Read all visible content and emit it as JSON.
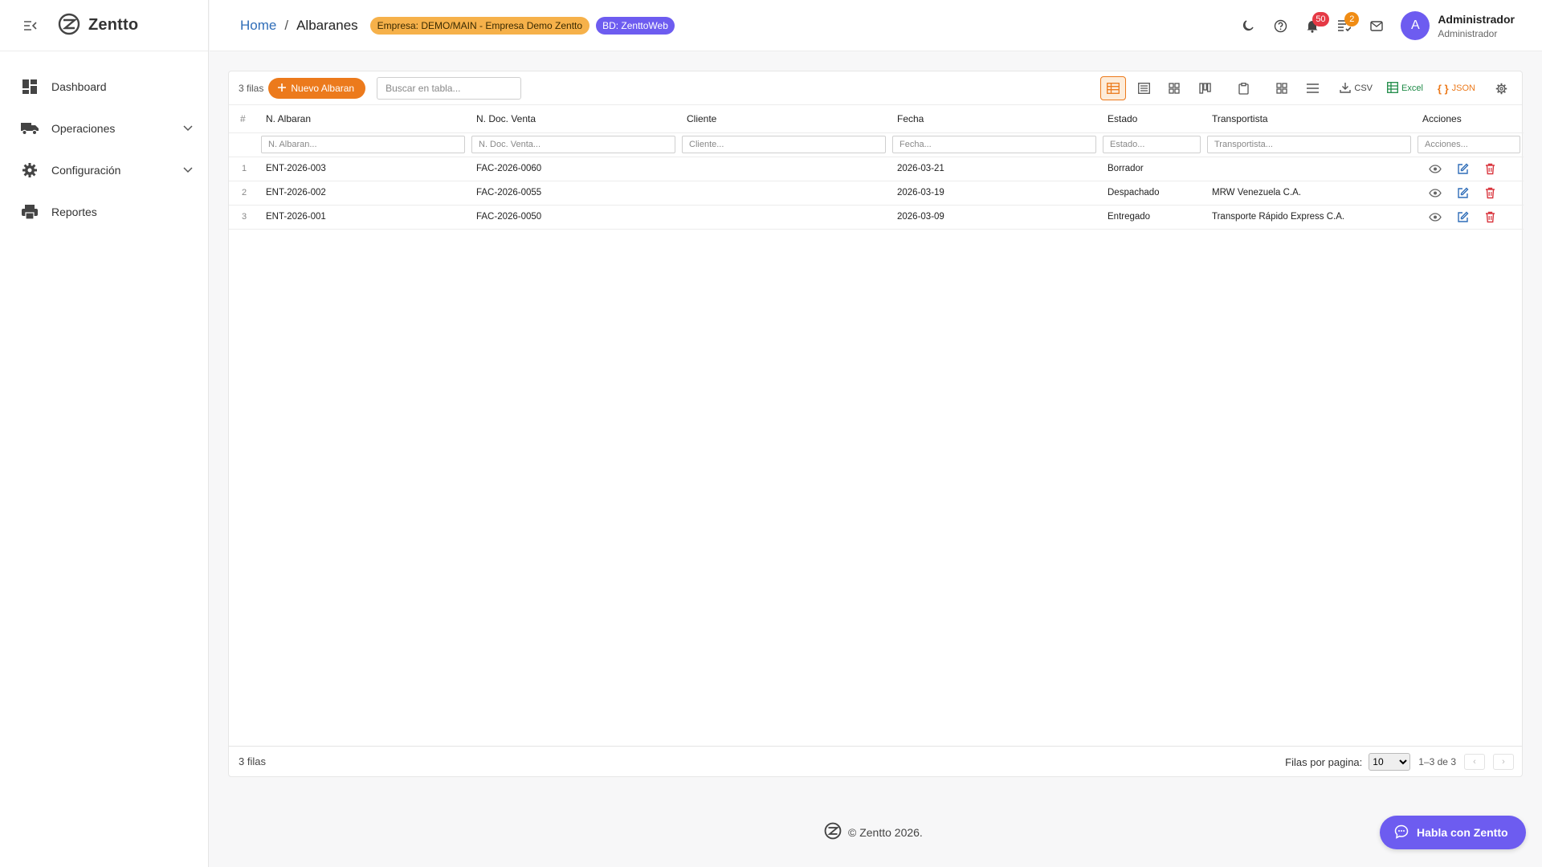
{
  "app": {
    "name": "Zentto"
  },
  "sidebar": {
    "items": [
      {
        "label": "Dashboard"
      },
      {
        "label": "Operaciones"
      },
      {
        "label": "Configuración"
      },
      {
        "label": "Reportes"
      }
    ]
  },
  "header": {
    "breadcrumb_home": "Home",
    "breadcrumb_sep": "/",
    "breadcrumb_current": "Albaranes",
    "company_badge": "Empresa: DEMO/MAIN - Empresa Demo Zentto",
    "db_badge": "BD: ZenttoWeb",
    "notifications_count": "50",
    "tasks_count": "2",
    "user_name": "Administrador",
    "user_role": "Administrador",
    "avatar_letter": "A"
  },
  "toolbar": {
    "rows_count": "3 filas",
    "new_button": "Nuevo Albaran",
    "search_placeholder": "Buscar en tabla...",
    "csv_label": "CSV",
    "excel_label": "Excel",
    "json_label": "JSON"
  },
  "table": {
    "index_header": "#",
    "columns": [
      "N. Albaran",
      "N. Doc. Venta",
      "Cliente",
      "Fecha",
      "Estado",
      "Transportista",
      "Acciones"
    ],
    "filters": [
      "N. Albaran...",
      "N. Doc. Venta...",
      "Cliente...",
      "Fecha...",
      "Estado...",
      "Transportista...",
      "Acciones..."
    ],
    "rows": [
      {
        "idx": "1",
        "albaran": "ENT-2026-003",
        "doc_venta": "FAC-2026-0060",
        "cliente": "",
        "fecha": "2026-03-21",
        "estado": "Borrador",
        "transportista": ""
      },
      {
        "idx": "2",
        "albaran": "ENT-2026-002",
        "doc_venta": "FAC-2026-0055",
        "cliente": "",
        "fecha": "2026-03-19",
        "estado": "Despachado",
        "transportista": "MRW Venezuela C.A."
      },
      {
        "idx": "3",
        "albaran": "ENT-2026-001",
        "doc_venta": "FAC-2026-0050",
        "cliente": "",
        "fecha": "2026-03-09",
        "estado": "Entregado",
        "transportista": "Transporte Rápido Express C.A."
      }
    ]
  },
  "footer": {
    "rows_total": "3 filas",
    "rows_per_page_label": "Filas por pagina:",
    "rows_per_page_value": "10",
    "range": "1–3 de 3",
    "prev": "‹",
    "next": "›"
  },
  "copyright": "© Zentto 2026.",
  "chat_button": "Habla con Zentto",
  "colors": {
    "accent_orange": "#ec7a1c",
    "brand_purple": "#6d5cf0",
    "link_blue": "#2f6db8",
    "delete_red": "#d9363e",
    "excel_green": "#1d8a46"
  }
}
